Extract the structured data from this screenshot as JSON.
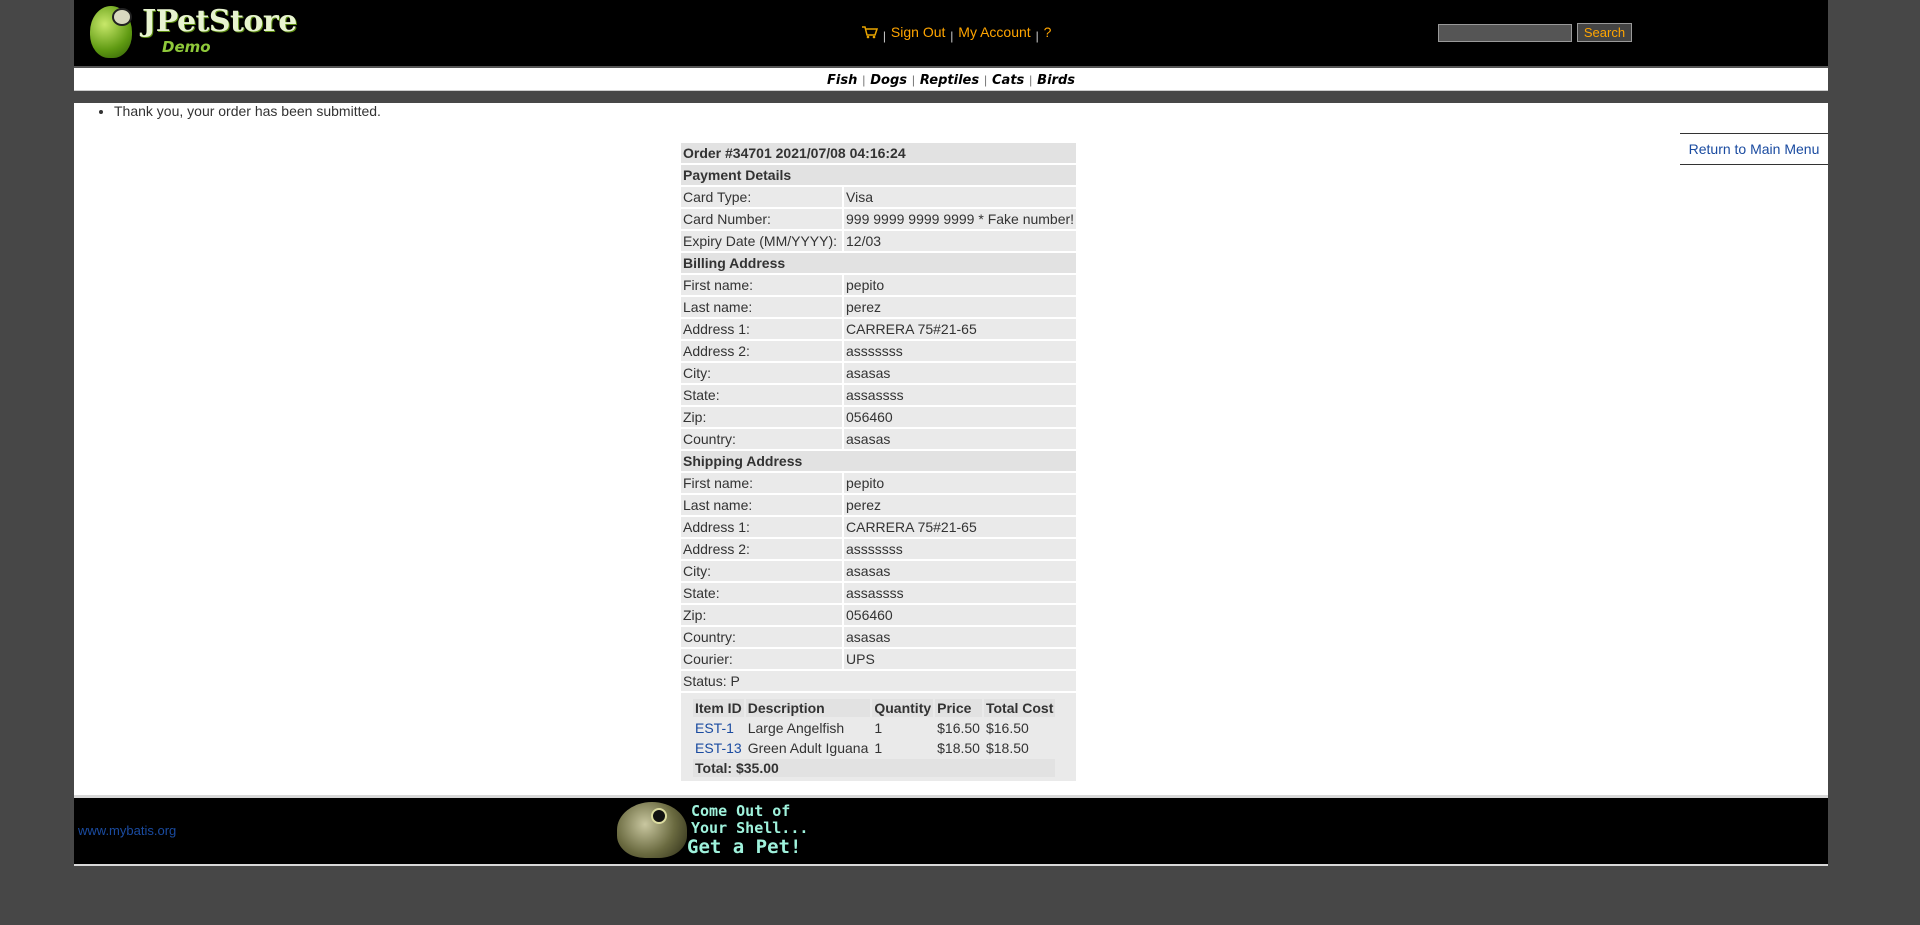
{
  "header": {
    "logo_name": "JPetStore",
    "logo_sub": "Demo",
    "menu": {
      "sign_out": "Sign Out",
      "my_account": "My Account",
      "help": "?",
      "separator": "|"
    },
    "search": {
      "placeholder": "",
      "value": "",
      "button_label": "Search"
    }
  },
  "quicklinks": [
    {
      "label": "Fish"
    },
    {
      "label": "Dogs"
    },
    {
      "label": "Reptiles"
    },
    {
      "label": "Cats"
    },
    {
      "label": "Birds"
    }
  ],
  "messages": [
    "Thank you, your order has been submitted."
  ],
  "back_link": "Return to Main Menu",
  "order": {
    "title": "Order #34701 2021/07/08 04:16:24",
    "payment": {
      "heading": "Payment Details",
      "rows": [
        {
          "label": "Card Type:",
          "value": "Visa"
        },
        {
          "label": "Card Number:",
          "value": "999 9999 9999 9999 * Fake number!"
        },
        {
          "label": "Expiry Date (MM/YYYY):",
          "value": "12/03"
        }
      ]
    },
    "billing": {
      "heading": "Billing Address",
      "rows": [
        {
          "label": "First name:",
          "value": "pepito"
        },
        {
          "label": "Last name:",
          "value": "perez"
        },
        {
          "label": "Address 1:",
          "value": "CARRERA 75#21-65"
        },
        {
          "label": "Address 2:",
          "value": "asssssss"
        },
        {
          "label": "City:",
          "value": "asasas"
        },
        {
          "label": "State:",
          "value": "assassss"
        },
        {
          "label": "Zip:",
          "value": "056460"
        },
        {
          "label": "Country:",
          "value": "asasas"
        }
      ]
    },
    "shipping": {
      "heading": "Shipping Address",
      "rows": [
        {
          "label": "First name:",
          "value": "pepito"
        },
        {
          "label": "Last name:",
          "value": "perez"
        },
        {
          "label": "Address 1:",
          "value": "CARRERA 75#21-65"
        },
        {
          "label": "Address 2:",
          "value": "asssssss"
        },
        {
          "label": "City:",
          "value": "asasas"
        },
        {
          "label": "State:",
          "value": "assassss"
        },
        {
          "label": "Zip:",
          "value": "056460"
        },
        {
          "label": "Country:",
          "value": "asasas"
        },
        {
          "label": "Courier:",
          "value": "UPS"
        }
      ]
    },
    "status": "Status: P",
    "items": {
      "columns": [
        "Item ID",
        "Description",
        "Quantity",
        "Price",
        "Total Cost"
      ],
      "rows": [
        {
          "id": "EST-1",
          "description": "Large Angelfish",
          "quantity": "1",
          "price": "$16.50",
          "total": "$16.50"
        },
        {
          "id": "EST-13",
          "description": "Green Adult Iguana",
          "quantity": "1",
          "price": "$18.50",
          "total": "$18.50"
        }
      ],
      "grand_total": "Total: $35.00"
    }
  },
  "footer": {
    "link": "www.mybatis.org",
    "banner_lines": [
      "Come Out of",
      "Your Shell...",
      "Get a Pet!"
    ]
  }
}
